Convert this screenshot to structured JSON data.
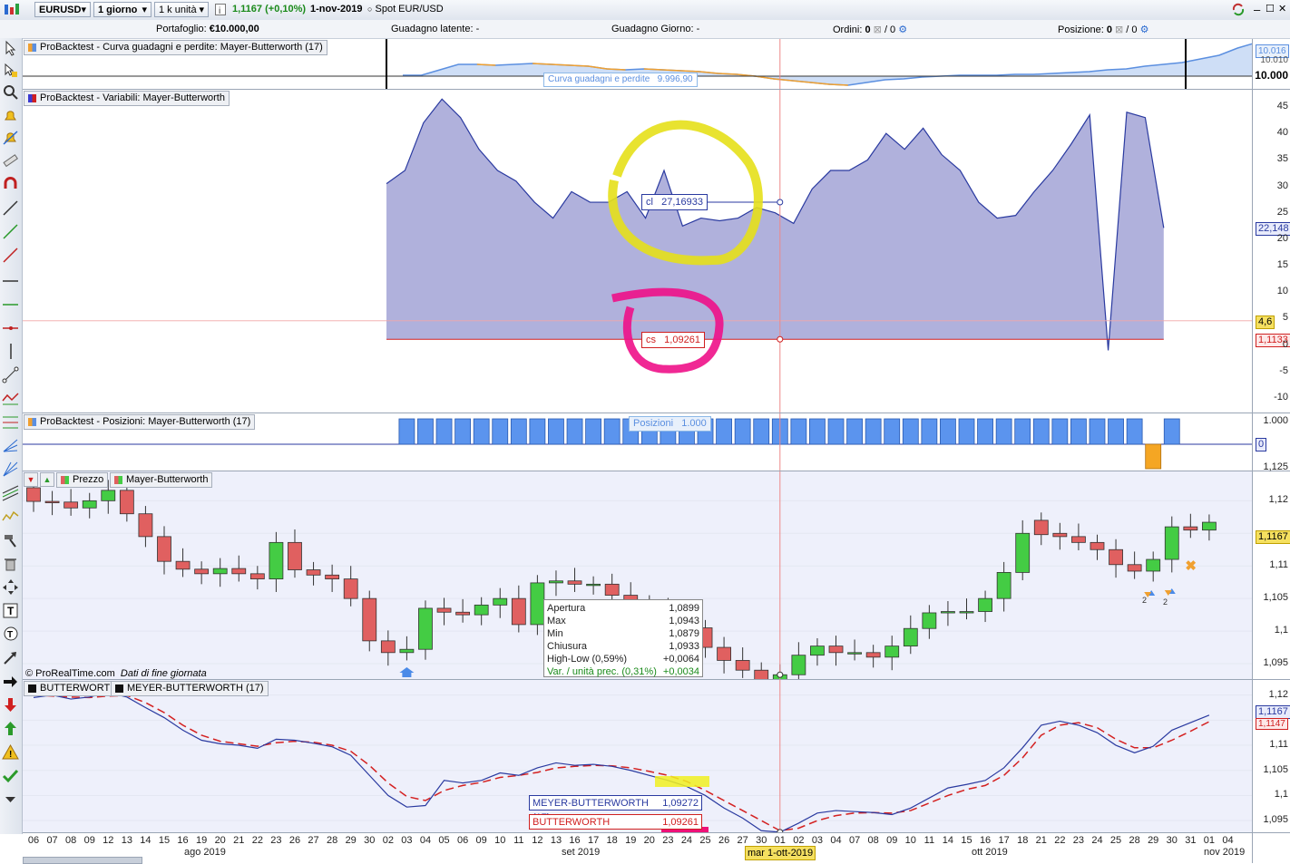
{
  "toolbar": {
    "symbol": "EURUSD",
    "timeframe": "1 giorno",
    "unit": "1 k unità",
    "price": "1,1167",
    "change": "(+0,10%)",
    "date": "1-nov-2019",
    "spot": "Spot EUR/USD"
  },
  "accountbar": {
    "portfolio_label": "Portafoglio:",
    "portfolio_value": "€10.000,00",
    "latent_label": "Guadagno latente:",
    "latent_value": "-",
    "day_label": "Guadagno Giorno:",
    "day_value": "-",
    "orders_label": "Ordini:",
    "orders_value": "0",
    "orders_sep": "/ 0",
    "position_label": "Posizione:",
    "position_value": "0",
    "position_sep": "/ 0"
  },
  "equity_panel": {
    "title": "ProBacktest - Curva guadagni e perdite: Mayer-Butterworth (17)",
    "tooltip_label": "Curva guadagni e perdite",
    "tooltip_value": "9.996,90",
    "axis_labels": [
      "10.016",
      "10.010",
      "10.000"
    ]
  },
  "variables_panel": {
    "title": "ProBacktest - Variabili: Mayer-Butterworth",
    "axis_labels": [
      "45",
      "40",
      "35",
      "30",
      "25",
      "20",
      "15",
      "10",
      "5",
      "0",
      "-5",
      "-10"
    ],
    "flag_cl": "22,148",
    "flag_mid": "4,6",
    "flag_cs": "1,1133",
    "cl_label": "cl",
    "cl_value": "27,16933",
    "cs_label": "cs",
    "cs_value": "1,09261"
  },
  "positions_panel": {
    "title": "ProBacktest - Posizioni: Mayer-Butterworth (17)",
    "tooltip_label": "Posizioni",
    "tooltip_value": "1.000",
    "axis_top": "1.000",
    "axis_zero": "0"
  },
  "price_panel": {
    "tab_price": "Prezzo",
    "tab_indicator": "Mayer-Butterworth",
    "axis_labels": [
      "1,125",
      "1,12",
      "1,115",
      "1,11",
      "1,105",
      "1,1",
      "1,095"
    ],
    "flag_price": "1,1167",
    "copyright": "© ProRealTime.com",
    "data_note": "Dati di fine giornata",
    "signal_count_1": "2",
    "signal_count_2": "2",
    "ohlc": {
      "open_label": "Apertura",
      "open_value": "1,0899",
      "high_label": "Max",
      "high_value": "1,0943",
      "low_label": "Min",
      "low_value": "1,0879",
      "close_label": "Chiusura",
      "close_value": "1,0933",
      "hl_label": "High-Low (0,59%)",
      "hl_value": "+0,0064",
      "var_label": "Var. / unità prec. (0,31%)",
      "var_value": "+0,0034"
    }
  },
  "filter_panel": {
    "tab1": "BUTTERWORTH",
    "tab2": "MEYER-BUTTERWORTH (17)",
    "axis_labels": [
      "1,12",
      "1,115",
      "1,11",
      "1,105",
      "1,1",
      "1,095"
    ],
    "flag_meyer": "1,1167",
    "flag_butter": "1,1147",
    "tip_meyer_label": "MEYER-BUTTERWORTH (17)",
    "tip_meyer_value": "1,09272",
    "tip_butter_label": "BUTTERWORTH",
    "tip_butter_value": "1,09261"
  },
  "date_axis": {
    "days": [
      "06",
      "07",
      "08",
      "09",
      "12",
      "13",
      "14",
      "15",
      "16",
      "19",
      "20",
      "21",
      "22",
      "23",
      "26",
      "27",
      "28",
      "29",
      "30",
      "02",
      "03",
      "04",
      "05",
      "06",
      "09",
      "10",
      "11",
      "12",
      "13",
      "16",
      "17",
      "18",
      "19",
      "20",
      "23",
      "24",
      "25",
      "26",
      "27",
      "30",
      "01",
      "02",
      "03",
      "04",
      "07",
      "08",
      "09",
      "10",
      "11",
      "14",
      "15",
      "16",
      "17",
      "18",
      "21",
      "22",
      "23",
      "24",
      "25",
      "28",
      "29",
      "30",
      "31",
      "01",
      "04"
    ],
    "months": [
      "ago 2019",
      "set 2019",
      "ott 2019",
      "nov 2019"
    ],
    "cursor_label": "mar 1-ott-2019"
  },
  "colors": {
    "bull": "#44cc44",
    "bear": "#e06060",
    "fill": "#a7a9d8",
    "butter_line": "#d42020",
    "meyer_line": "#2a3aa0",
    "equity_line": "#5b8fe0",
    "equity_loss": "#f0a030"
  },
  "chart_data": {
    "type": "candlestick",
    "title": "EURUSD",
    "x": [
      "06",
      "07",
      "08",
      "09",
      "12",
      "13",
      "14",
      "15",
      "16",
      "19",
      "20",
      "21",
      "22",
      "23",
      "26",
      "27",
      "28",
      "29",
      "30",
      "02",
      "03",
      "04",
      "05",
      "06",
      "09",
      "10",
      "11",
      "12",
      "13",
      "16",
      "17",
      "18",
      "19",
      "20",
      "23",
      "24",
      "25",
      "26",
      "27",
      "30",
      "01",
      "02",
      "03",
      "04",
      "07",
      "08",
      "09",
      "10",
      "11",
      "14",
      "15",
      "16",
      "17",
      "18",
      "21",
      "22",
      "23",
      "24",
      "25",
      "28",
      "29",
      "30",
      "31",
      "01"
    ],
    "open": [
      1.122,
      1.1199,
      1.1198,
      1.1189,
      1.12,
      1.1216,
      1.118,
      1.1145,
      1.1107,
      1.1095,
      1.1088,
      1.1096,
      1.1088,
      1.108,
      1.1136,
      1.1094,
      1.1086,
      1.108,
      1.105,
      1.0985,
      1.0967,
      1.0972,
      1.1035,
      1.1029,
      1.1025,
      1.104,
      1.105,
      1.101,
      1.1074,
      1.1077,
      1.1072,
      1.1072,
      1.1055,
      1.1043,
      1.1035,
      1.1018,
      1.1005,
      1.0975,
      1.0955,
      1.094,
      1.0899,
      1.0933,
      1.0963,
      1.0977,
      1.0967,
      1.0967,
      1.096,
      1.0977,
      1.1004,
      1.1028,
      1.103,
      1.103,
      1.105,
      1.109,
      1.117,
      1.115,
      1.1145,
      1.1136,
      1.1125,
      1.1102,
      1.1092,
      1.111,
      1.116,
      1.1155
    ],
    "close": [
      1.1199,
      1.1198,
      1.1189,
      1.12,
      1.1216,
      1.118,
      1.1145,
      1.1107,
      1.1095,
      1.1088,
      1.1096,
      1.1088,
      1.108,
      1.1136,
      1.1094,
      1.1086,
      1.108,
      1.105,
      1.0985,
      1.0967,
      1.0972,
      1.1035,
      1.1029,
      1.1025,
      1.104,
      1.105,
      1.101,
      1.1074,
      1.1077,
      1.1072,
      1.1072,
      1.1055,
      1.1043,
      1.1035,
      1.1018,
      1.1005,
      1.0975,
      1.0955,
      1.094,
      1.0899,
      1.0933,
      1.0963,
      1.0977,
      1.0967,
      1.0967,
      1.096,
      1.0977,
      1.1004,
      1.1028,
      1.103,
      1.103,
      1.105,
      1.109,
      1.115,
      1.1148,
      1.1145,
      1.1136,
      1.1125,
      1.1102,
      1.1092,
      1.111,
      1.116,
      1.1155,
      1.1167
    ],
    "series": [
      {
        "name": "MEYER-BUTTERWORTH (17)",
        "values": [
          1.1195,
          1.12,
          1.1192,
          1.1196,
          1.1205,
          1.1196,
          1.1175,
          1.1155,
          1.113,
          1.111,
          1.1103,
          1.11,
          1.1094,
          1.1112,
          1.111,
          1.1104,
          1.1097,
          1.108,
          1.104,
          1.1,
          1.0977,
          1.098,
          1.103,
          1.1025,
          1.103,
          1.1045,
          1.104,
          1.1055,
          1.1065,
          1.106,
          1.1062,
          1.1058,
          1.105,
          1.104,
          1.103,
          1.1018,
          1.1,
          1.0975,
          1.0955,
          1.093,
          1.0927,
          1.0945,
          1.0965,
          1.097,
          1.0968,
          1.0966,
          1.0962,
          1.0975,
          1.0995,
          1.1015,
          1.1022,
          1.103,
          1.1055,
          1.1095,
          1.114,
          1.1148,
          1.114,
          1.1125,
          1.11,
          1.1085,
          1.1098,
          1.113,
          1.1145,
          1.116
        ]
      },
      {
        "name": "BUTTERWORTH",
        "values": [
          1.12,
          1.1198,
          1.1196,
          1.1195,
          1.1198,
          1.1199,
          1.1185,
          1.1165,
          1.114,
          1.112,
          1.1108,
          1.1103,
          1.1098,
          1.1105,
          1.1108,
          1.1106,
          1.11,
          1.1088,
          1.106,
          1.1025,
          1.0998,
          1.099,
          1.101,
          1.102,
          1.1026,
          1.1036,
          1.104,
          1.1046,
          1.1055,
          1.1058,
          1.106,
          1.1059,
          1.1055,
          1.1048,
          1.104,
          1.1028,
          1.101,
          1.099,
          1.097,
          1.095,
          1.093,
          1.0935,
          1.095,
          1.096,
          1.0965,
          1.0966,
          1.0965,
          1.097,
          1.0985,
          1.1,
          1.1012,
          1.102,
          1.104,
          1.1075,
          1.112,
          1.114,
          1.1145,
          1.1135,
          1.1112,
          1.1095,
          1.1095,
          1.111,
          1.1128,
          1.1147
        ]
      },
      {
        "name": "cl",
        "values": [
          30.5,
          33,
          42,
          46.5,
          43,
          37,
          33,
          31,
          27,
          24,
          29,
          27,
          27,
          29,
          24,
          33,
          22.5,
          24,
          23.5,
          24,
          26,
          25,
          23,
          29.5,
          33,
          33,
          35,
          40,
          37,
          41,
          36,
          33,
          27,
          24,
          24.5,
          29,
          33,
          38,
          43.5,
          -1,
          44,
          43,
          22.148
        ]
      }
    ],
    "y_axis_price": [
      1.0925,
      1.1245
    ],
    "y_axis_filter": [
      1.0925,
      1.123
    ],
    "y_axis_variables": [
      -10,
      45
    ]
  }
}
